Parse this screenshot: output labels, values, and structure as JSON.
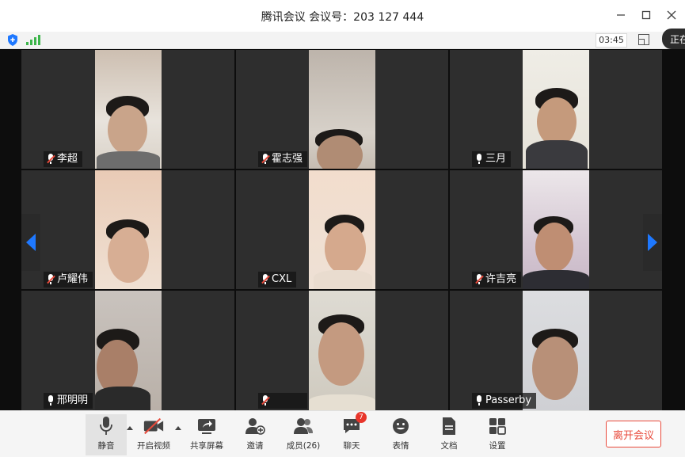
{
  "window": {
    "title": "腾讯会议  会议号：203 127 444",
    "controls": [
      "minimize-icon",
      "maximize-icon",
      "close-icon"
    ]
  },
  "statusbar": {
    "timer": "03:45",
    "speaking_label": "正在",
    "signal_color": "#3cb54a",
    "shield_color": "#1e78ff"
  },
  "participants": [
    {
      "name": "李超",
      "mic": "muted"
    },
    {
      "name": "霍志强",
      "mic": "muted"
    },
    {
      "name": "三月",
      "mic": "on"
    },
    {
      "name": "卢耀伟",
      "mic": "muted"
    },
    {
      "name": "CXL",
      "mic": "muted"
    },
    {
      "name": "许吉亮",
      "mic": "muted"
    },
    {
      "name": "邢明明",
      "mic": "on"
    },
    {
      "name": "",
      "mic": "muted"
    },
    {
      "name": "Passerby",
      "mic": "on"
    }
  ],
  "toolbar": {
    "mute": "静音",
    "video": "开启视频",
    "share": "共享屏幕",
    "invite": "邀请",
    "members": "成员(26)",
    "chat": "聊天",
    "chat_badge": "7",
    "emoji": "表情",
    "docs": "文档",
    "settings": "设置",
    "leave": "离开会议"
  },
  "colors": {
    "accent": "#1e78ff",
    "danger": "#e84a3b",
    "tile_bg": "#2e2e2e"
  }
}
